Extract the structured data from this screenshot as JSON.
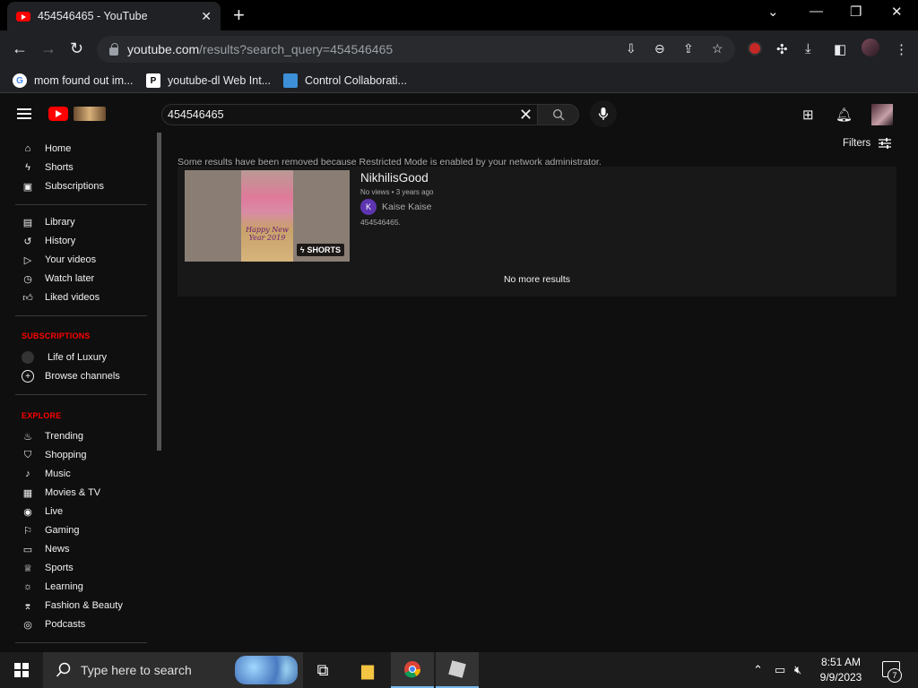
{
  "browser": {
    "tab_title": "454546465 - YouTube",
    "url_host": "youtube.com",
    "url_path": "/results?search_query=454546465",
    "bookmarks": [
      {
        "label": "mom found out im...",
        "icon": "google-icon"
      },
      {
        "label": "youtube-dl Web Int...",
        "icon": "pl-icon"
      },
      {
        "label": "Control Collaborati...",
        "icon": "monitor-icon"
      }
    ]
  },
  "header": {
    "search_query": "454546465"
  },
  "sidebar": {
    "main": [
      {
        "label": "Home",
        "icon": "home-icon"
      },
      {
        "label": "Shorts",
        "icon": "shorts-icon"
      },
      {
        "label": "Subscriptions",
        "icon": "subscriptions-icon"
      }
    ],
    "library": [
      {
        "label": "Library",
        "icon": "library-icon"
      },
      {
        "label": "History",
        "icon": "history-icon"
      },
      {
        "label": "Your videos",
        "icon": "your-videos-icon"
      },
      {
        "label": "Watch later",
        "icon": "clock-icon"
      },
      {
        "label": "Liked videos",
        "icon": "thumbs-up-icon"
      }
    ],
    "subscriptions_heading": "SUBSCRIPTIONS",
    "subscriptions": [
      {
        "label": "Life of Luxury"
      },
      {
        "label": "Browse channels"
      }
    ],
    "explore_heading": "EXPLORE",
    "explore": [
      {
        "label": "Trending"
      },
      {
        "label": "Shopping"
      },
      {
        "label": "Music"
      },
      {
        "label": "Movies & TV"
      },
      {
        "label": "Live"
      },
      {
        "label": "Gaming"
      },
      {
        "label": "News"
      },
      {
        "label": "Sports"
      },
      {
        "label": "Learning"
      },
      {
        "label": "Fashion & Beauty"
      },
      {
        "label": "Podcasts"
      }
    ]
  },
  "main": {
    "filters_label": "Filters",
    "notice": "Some results have been removed because Restricted Mode is enabled by your network administrator.",
    "result": {
      "title": "NikhilisGood",
      "meta": "No views • 3 years ago",
      "channel_initial": "K",
      "channel": "Kaise Kaise",
      "description": "454546465.",
      "badge": "SHORTS",
      "thumb_text": "Happy New Year 2019"
    },
    "no_more": "No more results"
  },
  "taskbar": {
    "search_placeholder": "Type here to search",
    "time": "8:51 AM",
    "date": "9/9/2023",
    "notification_count": "7"
  },
  "colors": {
    "yt_red": "#ff0000",
    "background": "#0f0f0f",
    "card": "#181818"
  }
}
